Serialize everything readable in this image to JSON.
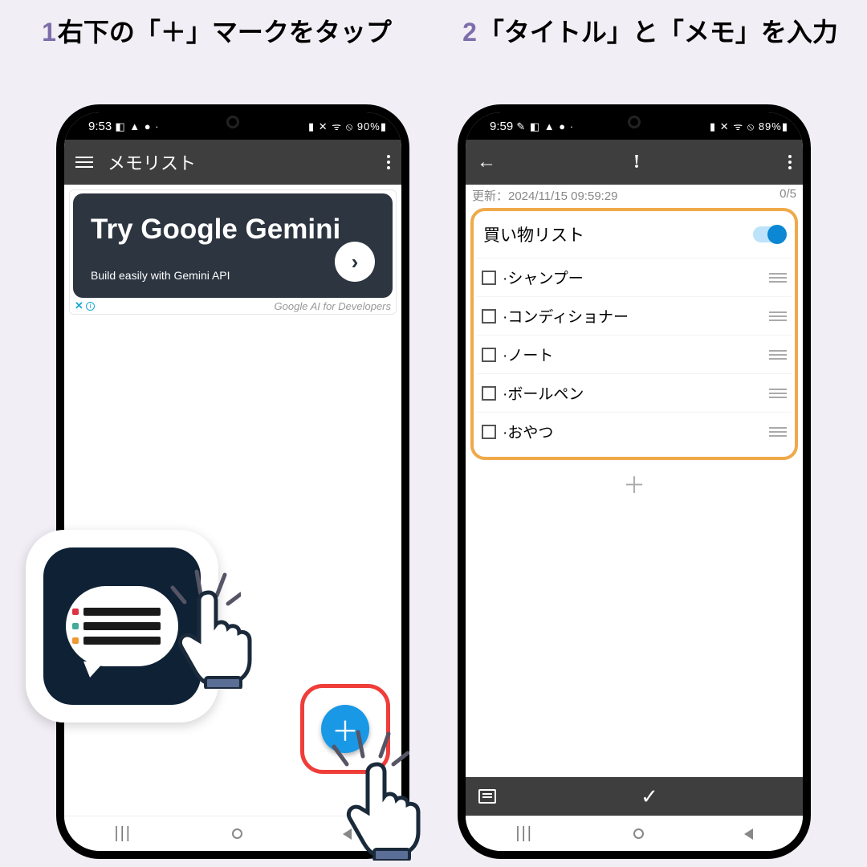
{
  "heading": {
    "step1_num": "1",
    "step1": "右下の「＋」マークをタップ",
    "step2_num": "2",
    "step2": "「タイトル」と「メモ」を入力"
  },
  "phone1": {
    "status_time": "9:53",
    "status_left_icons": "◧ ▲ ● ·",
    "status_right": "▮ ✕ ᯤ ⦸ 90%▮",
    "appbar_title": "メモリスト",
    "ad_title": "Try Google Gemini",
    "ad_sub": "Build easily with Gemini API",
    "ad_arrow": "›",
    "ad_close": "✕",
    "ad_info": "i",
    "ad_footer": "Google AI for Developers",
    "fab_plus": "＋",
    "nav_recent": "|||"
  },
  "phone2": {
    "status_time": "9:59",
    "status_left_icons": "✎ ◧ ▲ ● ·",
    "status_right": "▮ ✕ ᯤ ⦸ 89%▮",
    "meta_left": "更新：2024/11/15 09:59:29",
    "meta_right": "0/5",
    "title": "買い物リスト",
    "items": [
      "·シャンプー",
      "·コンディショナー",
      "·ノート",
      "·ボールペン",
      "·おやつ"
    ],
    "add": "＋",
    "check": "✓",
    "nav_recent": "|||"
  }
}
